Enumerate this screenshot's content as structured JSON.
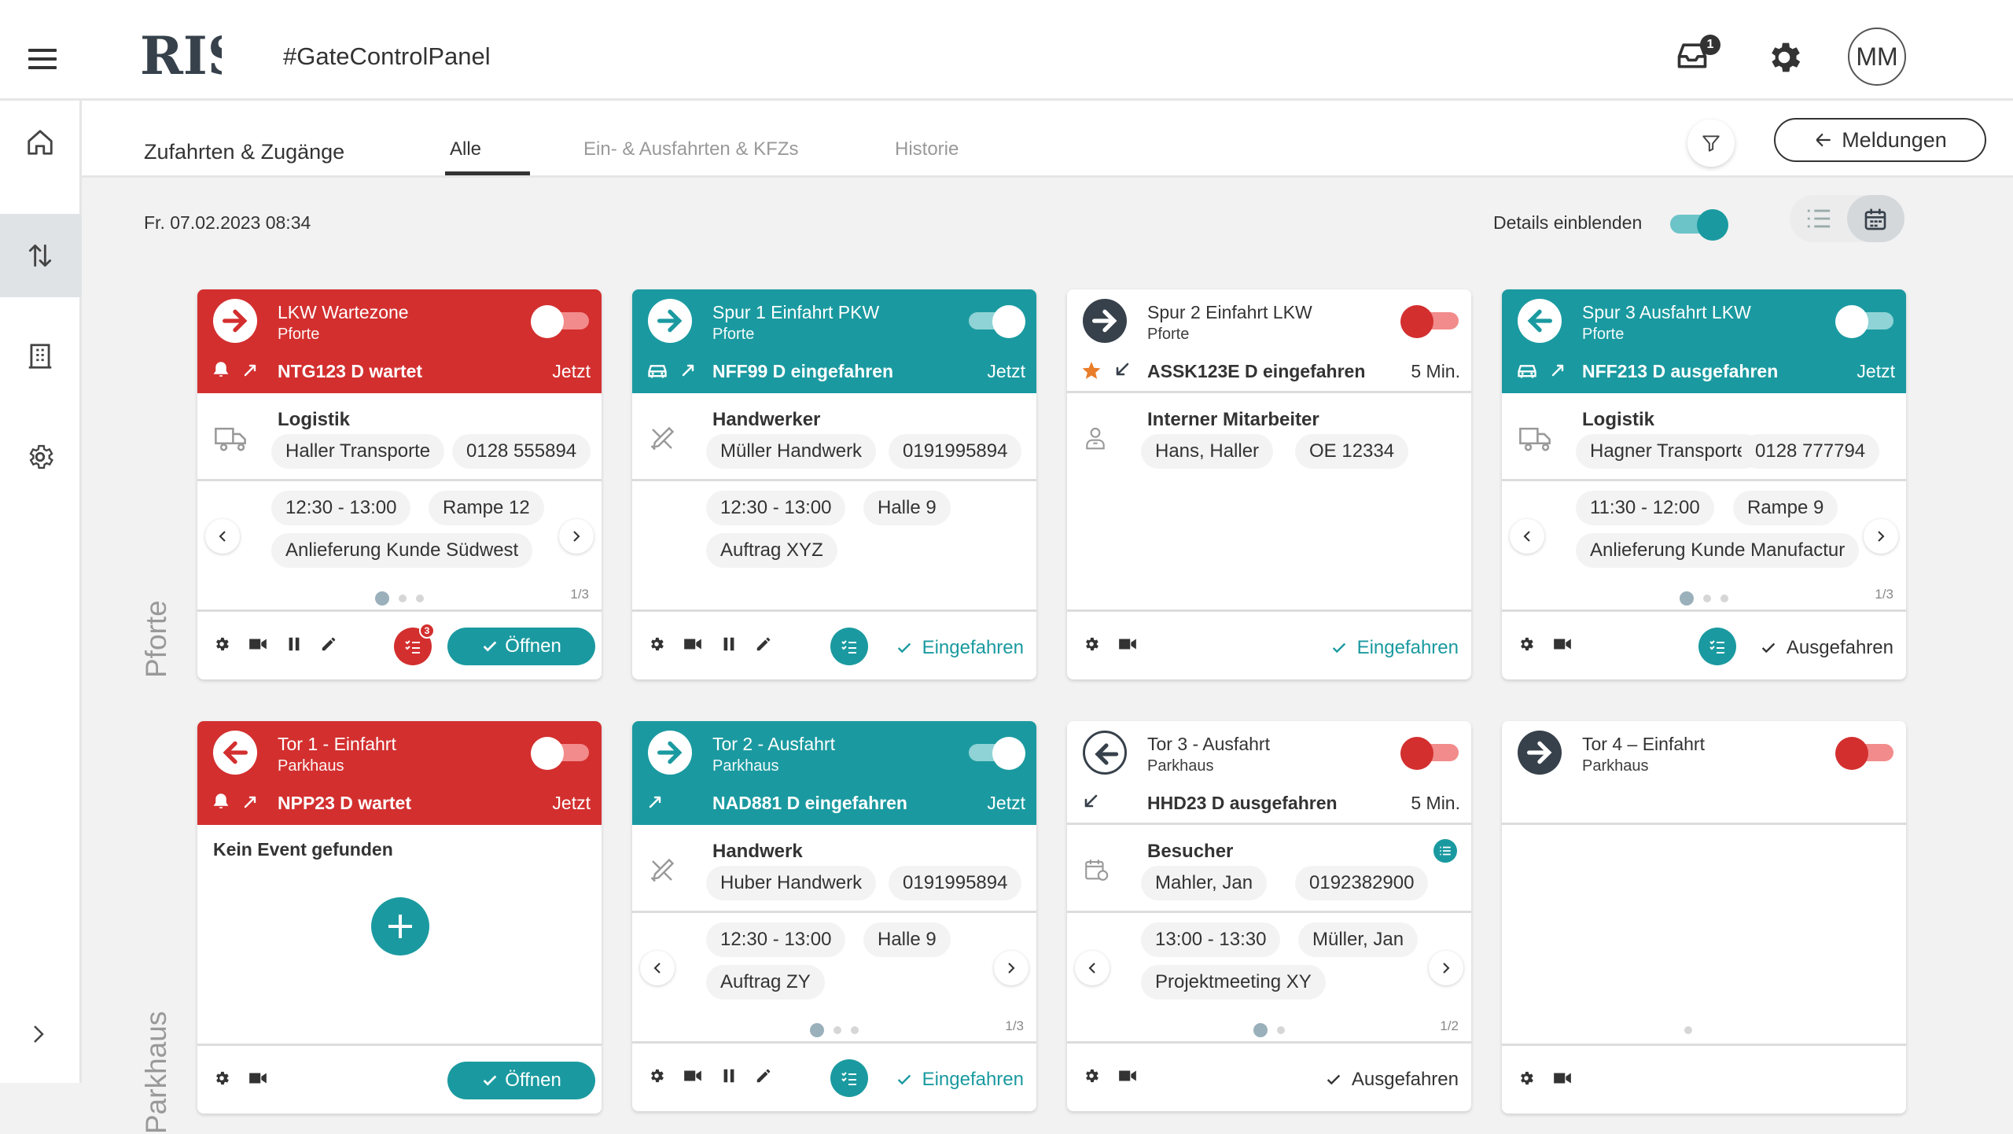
{
  "app": {
    "title": "#GateControlPanel",
    "logo_text": "RIS",
    "inbox_count": "1",
    "avatar": "MM"
  },
  "colors": {
    "accent": "#1a9aa0",
    "alert": "#d32f2f",
    "dark": "#37414b"
  },
  "section_title": "Zufahrten & Zugänge",
  "tabs": [
    "Alle",
    "Ein- & Ausfahrten & KFZs",
    "Historie"
  ],
  "meldungen_label": "Meldungen",
  "datetime": "Fr. 07.02.2023 08:34",
  "details_label": "Details einblenden",
  "rows": [
    "Pforte",
    "Parkhaus"
  ],
  "cards": [
    {
      "title": "LKW Wartezone",
      "sub": "Pforte",
      "status": "NTG123 D wartet",
      "time": "Jetzt",
      "category": "Logistik",
      "chip1": "Haller Transporte",
      "chip2": "0128 555894",
      "d1": "12:30  - 13:00",
      "d2": "Rampe 12",
      "d3": "Anlieferung Kunde Südwest",
      "page": "1/3",
      "list_count": "3",
      "open_label": "Öffnen"
    },
    {
      "title": "Spur 1 Einfahrt PKW",
      "sub": "Pforte",
      "status": "NFF99 D eingefahren",
      "time": "Jetzt",
      "category": "Handwerker",
      "chip1": "Müller Handwerk",
      "chip2": "0191995894",
      "d1": "12:30  - 13:00",
      "d2": "Halle 9",
      "d3": "Auftrag XYZ",
      "state_label": "Eingefahren"
    },
    {
      "title": "Spur 2 Einfahrt LKW",
      "sub": "Pforte",
      "status": "ASSK123E D eingefahren",
      "time": "5 Min.",
      "category": "Interner Mitarbeiter",
      "chip1": "Hans, Haller",
      "chip2": "OE 12334",
      "state_label": "Eingefahren"
    },
    {
      "title": "Spur 3 Ausfahrt LKW",
      "sub": "Pforte",
      "status": "NFF213 D ausgefahren",
      "time": "Jetzt",
      "category": "Logistik",
      "chip1": "Hagner Transporte",
      "chip2": "0128 777794",
      "d1": "11:30  - 12:00",
      "d2": "Rampe 9",
      "d3": "Anlieferung Kunde Manufactur",
      "page": "1/3",
      "state_label": "Ausgefahren"
    },
    {
      "title": "Tor 1 - Einfahrt",
      "sub": "Parkhaus",
      "status": "NPP23 D wartet",
      "time": "Jetzt",
      "empty": "Kein Event gefunden",
      "open_label": "Öffnen"
    },
    {
      "title": "Tor 2 - Ausfahrt",
      "sub": "Parkhaus",
      "status": "NAD881 D eingefahren",
      "time": "Jetzt",
      "category": "Handwerk",
      "chip1": "Huber Handwerk",
      "chip2": "0191995894",
      "d1": "12:30  - 13:00",
      "d2": "Halle 9",
      "d3": "Auftrag ZY",
      "page": "1/3",
      "state_label": "Eingefahren"
    },
    {
      "title": "Tor 3  - Ausfahrt",
      "sub": "Parkhaus",
      "status": "HHD23 D ausgefahren",
      "time": "5 Min.",
      "category": "Besucher",
      "chip1": "Mahler, Jan",
      "chip2": "0192382900",
      "d1": "13:00  - 13:30",
      "d2": "Müller, Jan",
      "d3": "Projektmeeting XY",
      "page": "1/2",
      "state_label": "Ausgefahren"
    },
    {
      "title": "Tor 4 – Einfahrt",
      "sub": "Parkhaus"
    }
  ]
}
